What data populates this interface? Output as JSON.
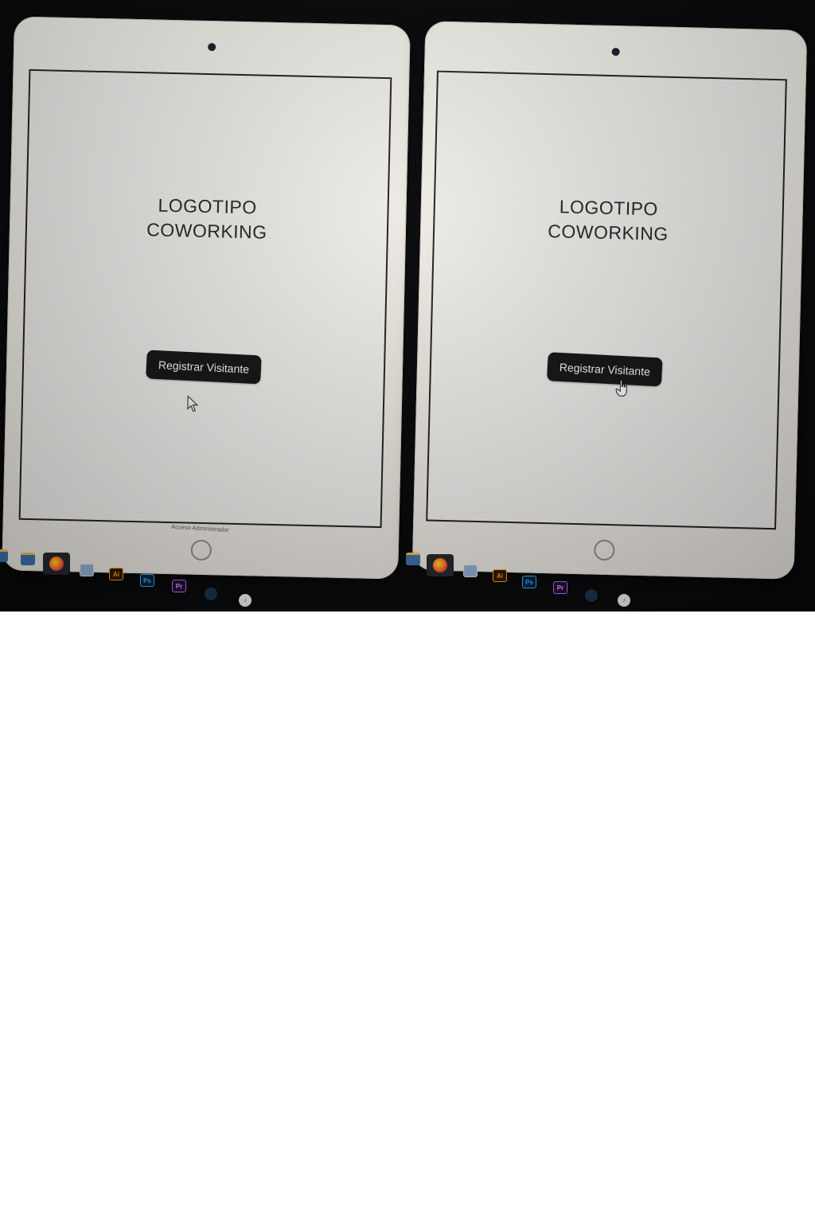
{
  "panels": [
    {
      "logo": {
        "line1": "LOGOTIPO",
        "line2": "COWORKING"
      },
      "register_button": "Registrar Visitante",
      "admin_link": "Acceso Administrador"
    },
    {
      "logo": {
        "line1": "LOGOTIPO",
        "line2": "COWORKING"
      },
      "register_button": "Registrar Visitante"
    }
  ],
  "taskbar": {
    "icons": [
      "folder-icon",
      "firefox-icon",
      "photos-icon",
      "illustrator-icon",
      "photoshop-icon",
      "premiere-icon",
      "steam-icon",
      "itunes-icon"
    ],
    "illustrator_label": "Ai",
    "photoshop_label": "Ps",
    "premiere_label": "Pr"
  },
  "colors": {
    "background": "#08090a",
    "device": "#efedea",
    "button": "#141414",
    "button_text": "#f5f5f5"
  }
}
